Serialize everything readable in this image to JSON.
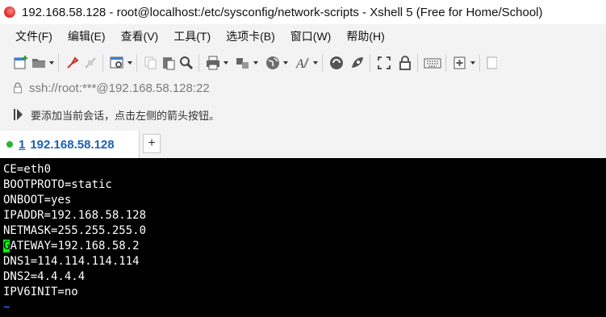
{
  "window": {
    "title": "192.168.58.128 - root@localhost:/etc/sysconfig/network-scripts - Xshell 5 (Free for Home/School)"
  },
  "menu": {
    "items": [
      {
        "label": "文件(F)"
      },
      {
        "label": "编辑(E)"
      },
      {
        "label": "查看(V)"
      },
      {
        "label": "工具(T)"
      },
      {
        "label": "选项卡(B)"
      },
      {
        "label": "窗口(W)"
      },
      {
        "label": "帮助(H)"
      }
    ]
  },
  "toolbar": {
    "icons": [
      "new-session-icon",
      "open-folder-icon",
      "connect-icon",
      "disconnect-icon",
      "properties-icon",
      "copy-icon",
      "paste-icon",
      "find-icon",
      "print-icon",
      "transfer-icon",
      "globe-icon",
      "font-icon",
      "xftp-icon",
      "xmanager-icon",
      "fullscreen-icon",
      "lock-icon",
      "keyboard-icon",
      "new-tab-icon"
    ]
  },
  "address": {
    "text": "ssh://root:***@192.168.58.128:22"
  },
  "hint": {
    "text": "要添加当前会话，点击左侧的箭头按钮。"
  },
  "tabs": [
    {
      "number": "1",
      "label": "192.168.58.128",
      "status_color": "#2bb52b"
    }
  ],
  "terminal": {
    "lines": [
      "CE=eth0",
      "BOOTPROTO=static",
      "ONBOOT=yes",
      "IPADDR=192.168.58.128",
      "NETMASK=255.255.255.0",
      "GATEWAY=192.168.58.2",
      "DNS1=114.114.114.114",
      "DNS2=4.4.4.4",
      "IPV6INIT=no"
    ],
    "cursor_line": {
      "cursor_char": "G",
      "rest": "ATEWAY=192.168.58.2"
    },
    "tilde": "~",
    "cursor_color": "#00ff00",
    "tilde_color": "#1e6eff"
  }
}
